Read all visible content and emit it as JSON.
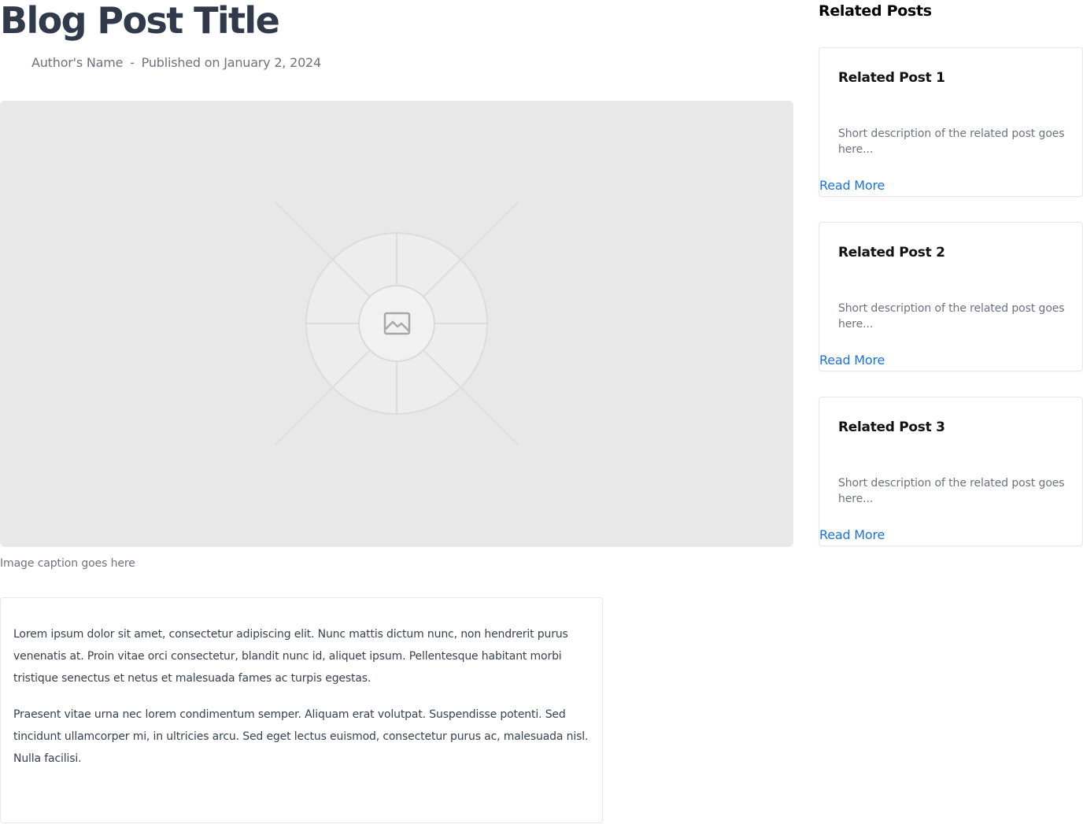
{
  "post": {
    "title": "Blog Post Title",
    "author": "Author's Name",
    "separator": "-",
    "published": "Published on January 2, 2024",
    "image_icon": "image-placeholder-icon",
    "caption": "Image caption goes here",
    "paragraphs": [
      "Lorem ipsum dolor sit amet, consectetur adipiscing elit. Nunc mattis dictum nunc, non hendrerit purus venenatis at. Proin vitae orci consectetur, blandit nunc id, aliquet ipsum. Pellentesque habitant morbi tristique senectus et netus et malesuada fames ac turpis egestas.",
      "Praesent vitae urna nec lorem condimentum semper. Aliquam erat volutpat. Suspendisse potenti. Sed tincidunt ullamcorper mi, in ultricies arcu. Sed eget lectus euismod, consectetur purus ac, malesuada nisl. Nulla facilisi."
    ]
  },
  "sidebar": {
    "heading": "Related Posts",
    "items": [
      {
        "title": "Related Post 1",
        "description": "Short description of the related post goes here...",
        "link": "Read More"
      },
      {
        "title": "Related Post 2",
        "description": "Short description of the related post goes here...",
        "link": "Read More"
      },
      {
        "title": "Related Post 3",
        "description": "Short description of the related post goes here...",
        "link": "Read More"
      }
    ]
  },
  "colors": {
    "title": "#313a4a",
    "meta": "#6b7280",
    "link": "#1a73d9",
    "image_bg": "#e8e8e8",
    "border": "#e5e7eb"
  }
}
